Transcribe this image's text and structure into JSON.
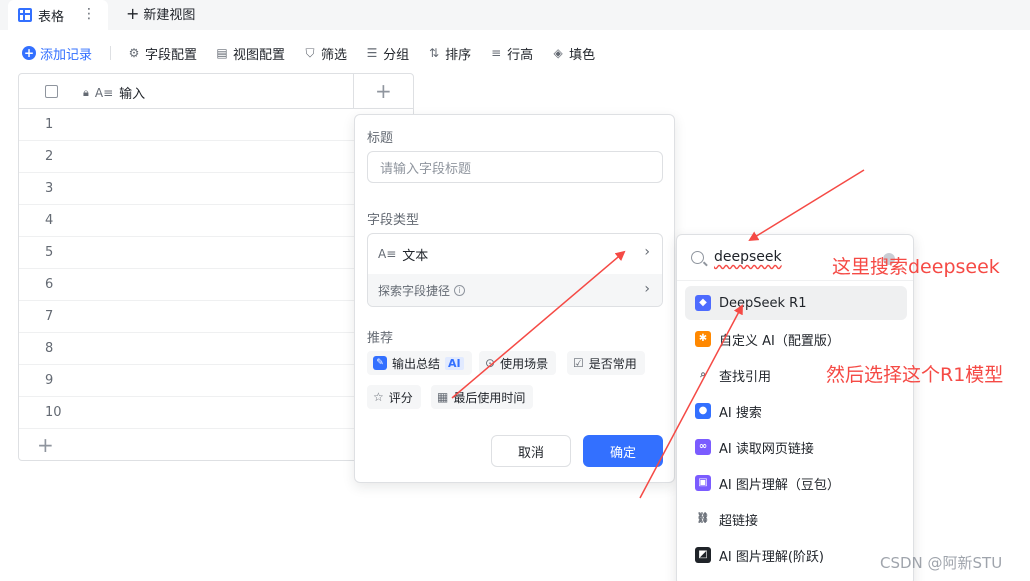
{
  "tabs": {
    "active_label": "表格",
    "more_glyph": "⋮",
    "new_view_label": "新建视图"
  },
  "toolbar": {
    "add_record": "添加记录",
    "field_config": "字段配置",
    "view_config": "视图配置",
    "filter": "筛选",
    "group": "分组",
    "sort": "排序",
    "row_height": "行高",
    "fill_color": "填色"
  },
  "grid": {
    "column_name": "输入",
    "rows": [
      "1",
      "2",
      "3",
      "4",
      "5",
      "6",
      "7",
      "8",
      "9",
      "10"
    ]
  },
  "field_panel": {
    "title_label": "标题",
    "title_placeholder": "请输入字段标题",
    "type_label": "字段类型",
    "type_value": "文本",
    "shortcut_label": "探索字段捷径",
    "recommend_label": "推荐",
    "recommend_chips": [
      "输出总结",
      "使用场景",
      "是否常用",
      "评分",
      "最后使用时间"
    ],
    "ai_badge": "AI",
    "cancel_label": "取消",
    "ok_label": "确定"
  },
  "type_dropdown": {
    "search_value": "deepseek",
    "items": [
      {
        "label": "DeepSeek R1",
        "icon": "deepseek-icon",
        "color": "#4d6bfe"
      },
      {
        "label": "自定义 AI（配置版）",
        "icon": "custom-ai-icon",
        "color": "#ff8800"
      },
      {
        "label": "查找引用",
        "icon": "lookup-icon",
        "color": "#646a73"
      },
      {
        "label": "AI 搜索",
        "icon": "ai-search-icon",
        "color": "#3370ff"
      },
      {
        "label": "AI 读取网页链接",
        "icon": "ai-link-icon",
        "color": "#7b5cff"
      },
      {
        "label": "AI 图片理解（豆包）",
        "icon": "ai-image-icon",
        "color": "#7b5cff"
      },
      {
        "label": "超链接",
        "icon": "hyperlink-icon",
        "color": "#646a73"
      },
      {
        "label": "AI 图片理解(阶跃)",
        "icon": "ai-image-step-icon",
        "color": "#1f2329"
      }
    ]
  },
  "annotations": {
    "search_note": "这里搜索deepseek",
    "select_note": "然后选择这个R1模型"
  },
  "watermark": "CSDN @阿新STU",
  "colors": {
    "accent": "#3370ff",
    "annotation_red": "#f54a45"
  }
}
